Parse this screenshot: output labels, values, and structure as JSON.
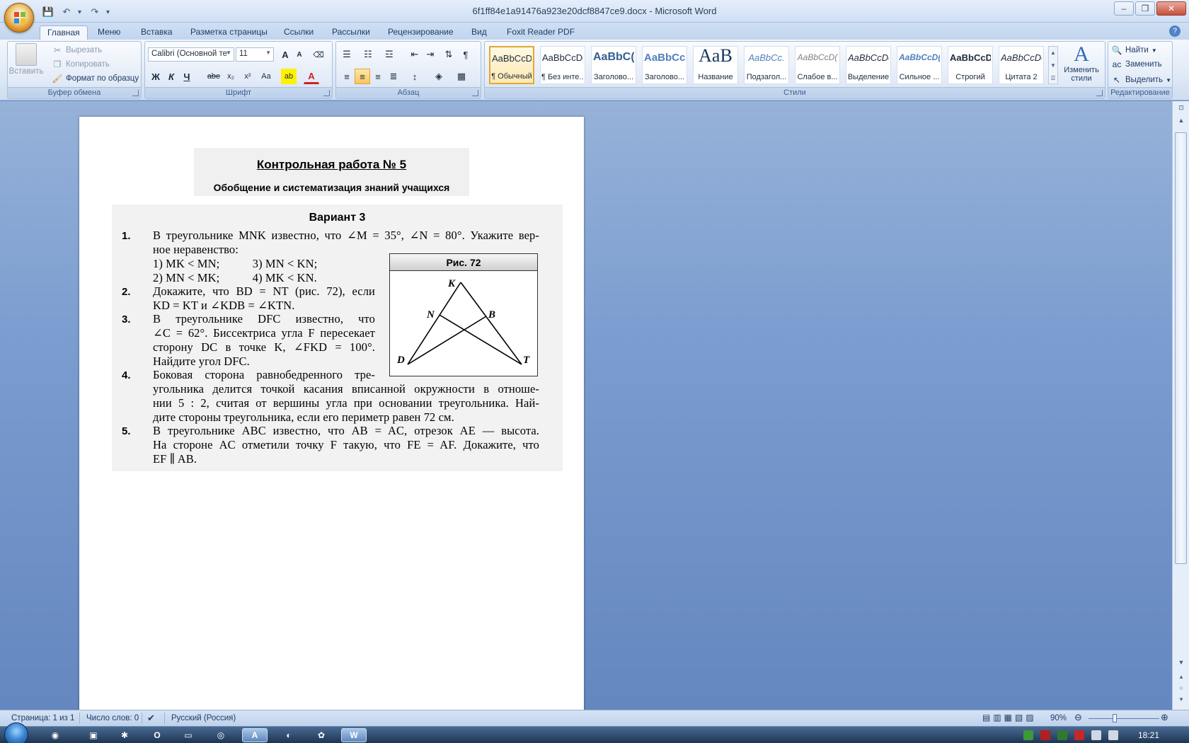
{
  "window": {
    "title": "6f1ff84e1a91476a923e20dcf8847ce9.docx - Microsoft Word"
  },
  "qat": {
    "save_icon": "save-icon",
    "undo_icon": "undo-icon",
    "redo_icon": "redo-icon"
  },
  "tabs": [
    {
      "label": "Главная"
    },
    {
      "label": "Меню"
    },
    {
      "label": "Вставка"
    },
    {
      "label": "Разметка страницы"
    },
    {
      "label": "Ссылки"
    },
    {
      "label": "Рассылки"
    },
    {
      "label": "Рецензирование"
    },
    {
      "label": "Вид"
    },
    {
      "label": "Foxit Reader PDF"
    }
  ],
  "clipboard": {
    "paste": "Вставить",
    "cut": "Вырезать",
    "copy": "Копировать",
    "format_painter": "Формат по образцу",
    "label": "Буфер обмена"
  },
  "font": {
    "name": "Calibri (Основной те",
    "size": "11",
    "label": "Шрифт",
    "bold": "Ж",
    "italic": "К",
    "underline": "Ч",
    "strike": "abe",
    "sub": "x₂",
    "sup": "x²",
    "case": "Aa",
    "grow": "A",
    "shrink": "A"
  },
  "paragraph": {
    "label": "Абзац"
  },
  "styles": {
    "label": "Стили",
    "items": [
      {
        "sample": "AaBbCcDc",
        "name": "¶ Обычный"
      },
      {
        "sample": "AaBbCcDc",
        "name": "¶ Без инте..."
      },
      {
        "sample": "AaBbC(",
        "name": "Заголово..."
      },
      {
        "sample": "AaBbCc",
        "name": "Заголово..."
      },
      {
        "sample": "AaB",
        "name": "Название"
      },
      {
        "sample": "AaBbCc.",
        "name": "Подзагол..."
      },
      {
        "sample": "AaBbCcD(",
        "name": "Слабое в..."
      },
      {
        "sample": "AaBbCcDc",
        "name": "Выделение"
      },
      {
        "sample": "AaBbCcD(",
        "name": "Сильное ..."
      },
      {
        "sample": "AaBbCcDc",
        "name": "Строгий"
      },
      {
        "sample": "AaBbCcDc",
        "name": "Цитата 2"
      }
    ],
    "change_line1": "Изменить",
    "change_line2": "стили"
  },
  "editing": {
    "label": "Редактирование",
    "find": "Найти",
    "replace": "Заменить",
    "select": "Выделить"
  },
  "doc": {
    "header_title": "Контрольная работа № 5",
    "header_sub": "Обобщение и систематизация знаний учащихся",
    "variant": "Вариант 3",
    "task_numbers": [
      "1.",
      "2.",
      "3.",
      "4.",
      "5."
    ],
    "lines": [
      "В треугольнике MNK известно, что ∠M = 35°, ∠N = 80°. Укажите вер-",
      "ное неравенство:",
      "1) MK < MN;           3) MN < KN;",
      "2) MN < MK;           4) MK < KN.",
      "Докажите, что BD = NT (рис. 72), если",
      "KD = KT и ∠KDB = ∠KTN.",
      "В треугольнике DFC известно, что",
      "∠C = 62°. Биссектриса угла F пересекает",
      "сторону DC в точке K, ∠FKD = 100°.",
      "Найдите угол DFC.",
      "Боковая сторона равнобедренного тре-",
      "угольника делится точкой касания вписанной окружности в отноше-",
      "нии 5 : 2, считая от вершины угла при основании треугольника. Най-",
      "дите стороны треугольника, если его периметр равен 72 см.",
      "В треугольнике ABC известно, что AB = AC, отрезок AE — высота.",
      "На стороне AC отметили точку F такую, что FE = AF. Докажите, что",
      "EF ∥ AB."
    ],
    "figure_title": "Рис. 72",
    "figure_labels": {
      "K": "K",
      "N": "N",
      "B": "B",
      "D": "D",
      "T": "T"
    }
  },
  "status": {
    "page": "Страница: 1 из 1",
    "words": "Число слов: 0",
    "language": "Русский (Россия)",
    "zoom": "90%"
  },
  "taskbar": {
    "clock": "18:21"
  }
}
